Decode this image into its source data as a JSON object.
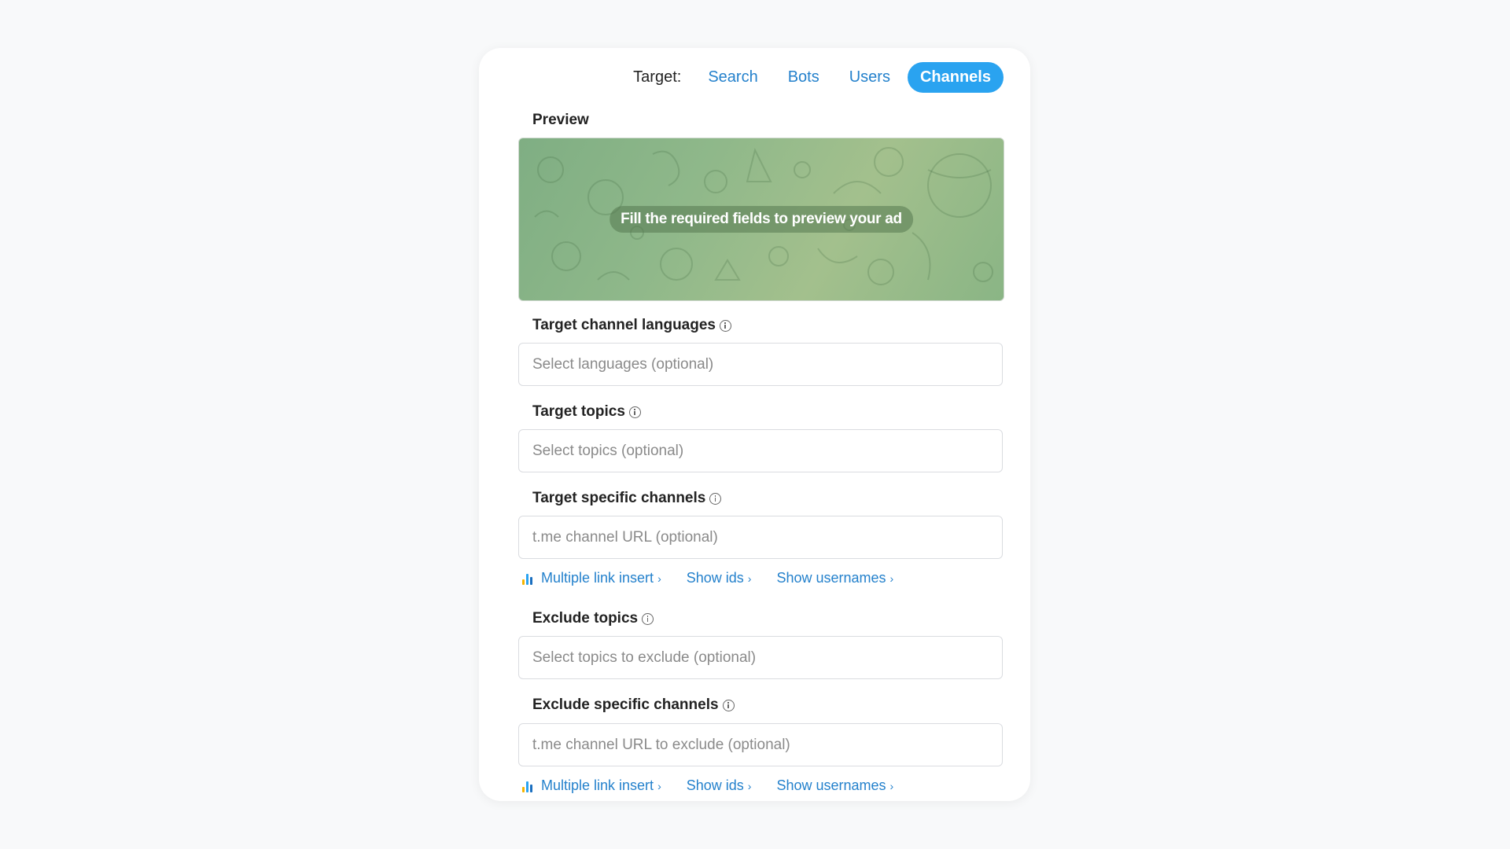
{
  "target": {
    "label": "Target:",
    "tabs": [
      {
        "label": "Search",
        "active": false
      },
      {
        "label": "Bots",
        "active": false
      },
      {
        "label": "Users",
        "active": false
      },
      {
        "label": "Channels",
        "active": true
      }
    ]
  },
  "preview": {
    "label": "Preview",
    "message": "Fill the required fields to preview your ad"
  },
  "fields": {
    "languages": {
      "label": "Target channel languages",
      "placeholder": "Select languages (optional)",
      "value": ""
    },
    "topics": {
      "label": "Target topics",
      "placeholder": "Select topics (optional)",
      "value": ""
    },
    "channels": {
      "label": "Target specific channels",
      "placeholder": "t.me channel URL (optional)",
      "value": ""
    },
    "exclude_topics": {
      "label": "Exclude topics",
      "placeholder": "Select topics to exclude (optional)",
      "value": ""
    },
    "exclude_channels": {
      "label": "Exclude specific channels",
      "placeholder": "t.me channel URL to exclude (optional)",
      "value": ""
    }
  },
  "links": {
    "multiple_link_insert": "Multiple link insert",
    "show_ids": "Show ids",
    "show_usernames": "Show usernames",
    "chevron": "›"
  },
  "icons": {
    "info": "info-circle-icon",
    "chart": "bar-chart-icon",
    "chart_colors": [
      "#f5b400",
      "#2aa3f0",
      "#1a6fc0"
    ]
  },
  "colors": {
    "accent": "#2aa3f0",
    "link": "#2481cc",
    "background": "#f8f9fa"
  }
}
